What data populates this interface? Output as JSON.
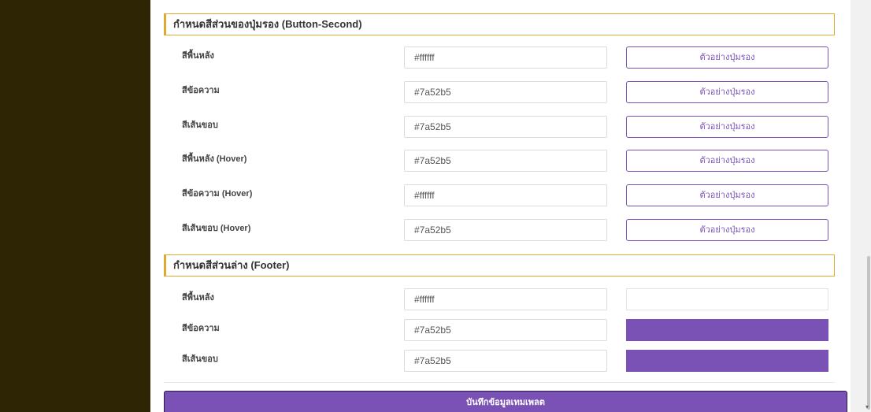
{
  "sections": {
    "button_second": {
      "title": "กำหนดสีส่วนของปุ่มรอง (Button-Second)",
      "rows": [
        {
          "label": "สีพื้นหลัง",
          "value": "#ffffff",
          "preview": "ตัวอย่างปุ่มรอง"
        },
        {
          "label": "สีข้อความ",
          "value": "#7a52b5",
          "preview": "ตัวอย่างปุ่มรอง"
        },
        {
          "label": "สีเส้นขอบ",
          "value": "#7a52b5",
          "preview": "ตัวอย่างปุ่มรอง"
        },
        {
          "label": "สีพื้นหลัง (Hover)",
          "value": "#7a52b5",
          "preview": "ตัวอย่างปุ่มรอง"
        },
        {
          "label": "สีข้อความ (Hover)",
          "value": "#ffffff",
          "preview": "ตัวอย่างปุ่มรอง"
        },
        {
          "label": "สีเส้นขอบ (Hover)",
          "value": "#7a52b5",
          "preview": "ตัวอย่างปุ่มรอง"
        }
      ]
    },
    "footer": {
      "title": "กำหนดสีส่วนล่าง (Footer)",
      "rows": [
        {
          "label": "สีพื้นหลัง",
          "value": "#ffffff",
          "swatch_color": "#ffffff"
        },
        {
          "label": "สีข้อความ",
          "value": "#7a52b5",
          "swatch_color": "#7a52b5"
        },
        {
          "label": "สีเส้นขอบ",
          "value": "#7a52b5",
          "swatch_color": "#7a52b5"
        }
      ]
    }
  },
  "save_button_label": "บันทึกข้อมูลเทมเพลต",
  "colors": {
    "accent": "#7a52b5",
    "section_border": "#e0a82e",
    "sidebar": "#2e2505"
  }
}
